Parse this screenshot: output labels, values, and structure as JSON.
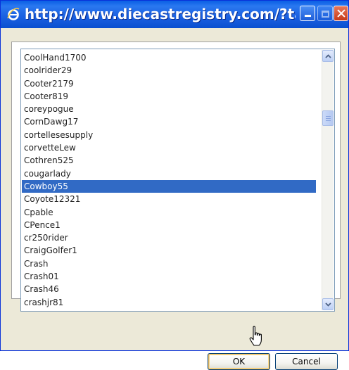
{
  "window": {
    "title": "http://www.diecastregistry.com/?targ...",
    "icons": {
      "app": "internet-explorer-icon",
      "minimize": "minimize-icon",
      "maximize": "maximize-icon",
      "close": "close-icon"
    },
    "colors": {
      "titlebar": "#0a5fe4",
      "selection": "#316ac5",
      "close": "#c63a1a"
    }
  },
  "list": {
    "items": [
      "CoolHand1700",
      "coolrider29",
      "Cooter2179",
      "Cooter819",
      "coreypogue",
      "CornDawg17",
      "cortellesesupply",
      "corvetteLew",
      "Cothren525",
      "cougarlady",
      "Cowboy55",
      "Coyote12321",
      "Cpable",
      "CPence1",
      "cr250rider",
      "CraigGolfer1",
      "Crash",
      "Crash01",
      "Crash46",
      "crashjr81"
    ],
    "selected_index": 10,
    "selected_value": "Cowboy55"
  },
  "buttons": {
    "ok_label": "OK",
    "cancel_label": "Cancel"
  }
}
